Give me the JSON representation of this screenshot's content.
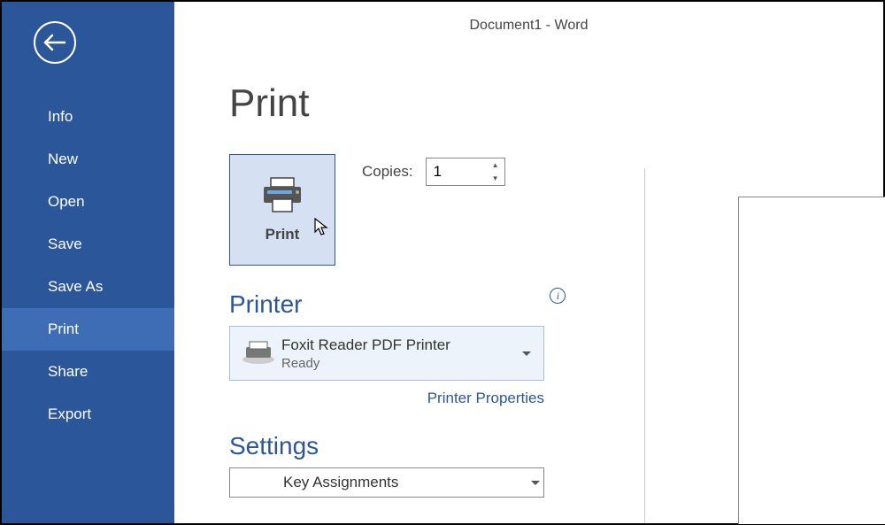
{
  "window_title": "Document1 - Word",
  "sidebar": {
    "items": [
      {
        "label": "Info"
      },
      {
        "label": "New"
      },
      {
        "label": "Open"
      },
      {
        "label": "Save"
      },
      {
        "label": "Save As"
      },
      {
        "label": "Print"
      },
      {
        "label": "Share"
      },
      {
        "label": "Export"
      }
    ]
  },
  "page_title": "Print",
  "print_button_label": "Print",
  "copies": {
    "label": "Copies:",
    "value": "1"
  },
  "printer": {
    "heading": "Printer",
    "selected_name": "Foxit Reader PDF Printer",
    "selected_status": "Ready",
    "properties_link": "Printer Properties"
  },
  "settings": {
    "heading": "Settings",
    "selected": "Key Assignments"
  }
}
